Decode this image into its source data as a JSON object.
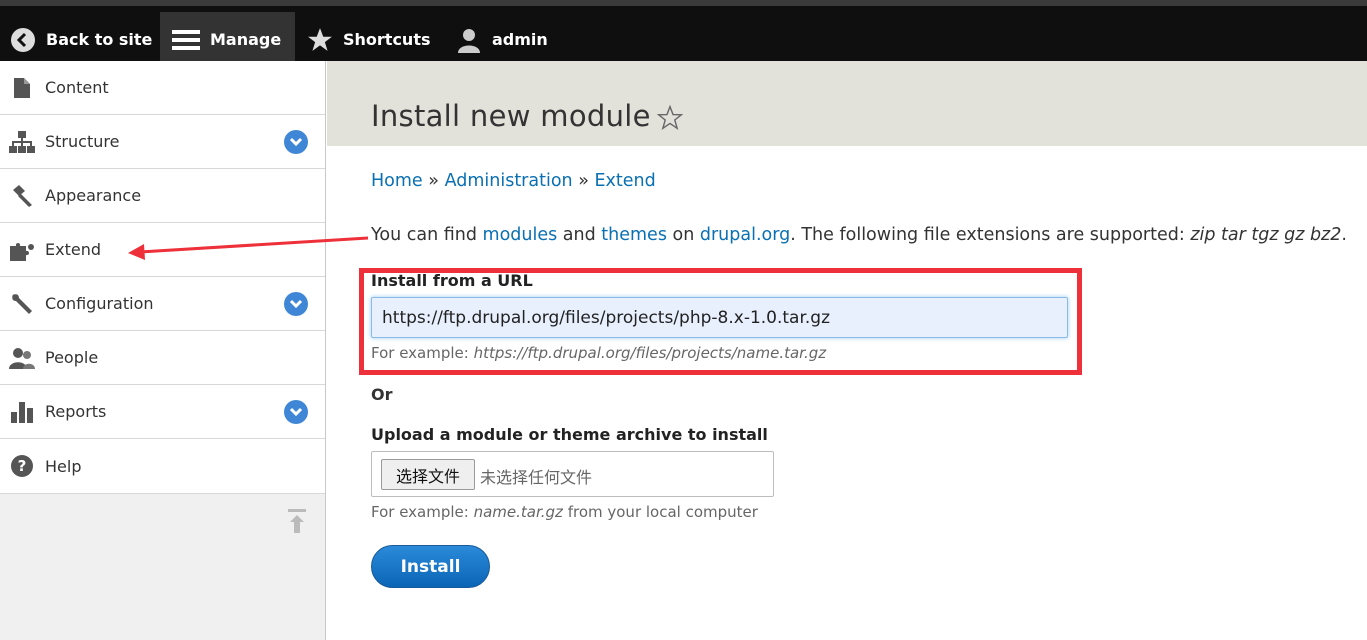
{
  "toolbar": {
    "back_label": "Back to site",
    "manage_label": "Manage",
    "shortcuts_label": "Shortcuts",
    "user_label": "admin"
  },
  "sidebar": {
    "items": [
      {
        "label": "Content",
        "icon": "file-icon",
        "expandable": false
      },
      {
        "label": "Structure",
        "icon": "sitemap-icon",
        "expandable": true
      },
      {
        "label": "Appearance",
        "icon": "paintbrush-icon",
        "expandable": false
      },
      {
        "label": "Extend",
        "icon": "puzzle-icon",
        "expandable": false
      },
      {
        "label": "Configuration",
        "icon": "wrench-icon",
        "expandable": true
      },
      {
        "label": "People",
        "icon": "people-icon",
        "expandable": false
      },
      {
        "label": "Reports",
        "icon": "bar-chart-icon",
        "expandable": true
      },
      {
        "label": "Help",
        "icon": "help-icon",
        "expandable": false
      }
    ]
  },
  "page": {
    "title": "Install new module"
  },
  "breadcrumb": {
    "home": "Home",
    "sep1": "»",
    "administration": "Administration",
    "sep2": "»",
    "extend": "Extend"
  },
  "intro": {
    "part1": "You can find ",
    "modules_link": "modules",
    "part2": " and ",
    "themes_link": "themes",
    "part3": " on ",
    "drupal_link": "drupal.org",
    "part4": ". The following file extensions are supported: ",
    "extensions": "zip tar tgz gz bz2",
    "part5": "."
  },
  "url_field": {
    "label": "Install from a URL",
    "value": "https://ftp.drupal.org/files/projects/php-8.x-1.0.tar.gz",
    "help_prefix": "For example: ",
    "help_example": "https://ftp.drupal.org/files/projects/name.tar.gz"
  },
  "or_text": "Or",
  "upload_field": {
    "label": "Upload a module or theme archive to install",
    "button": "选择文件",
    "status": "未选择任何文件",
    "help_prefix": "For example: ",
    "help_example": "name.tar.gz",
    "help_suffix": " from your local computer"
  },
  "install_button": "Install",
  "colors": {
    "annotation": "#ee303a",
    "link": "#0a70b3",
    "button": "#1b75c6",
    "expand_badge": "#3f87d6"
  }
}
